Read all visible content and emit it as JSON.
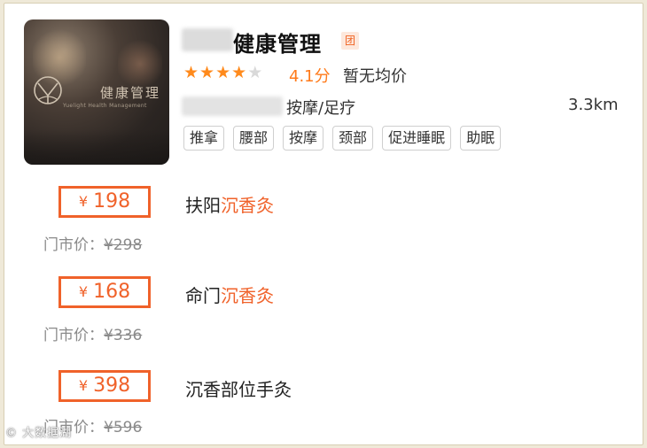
{
  "shop": {
    "name": "健康管理",
    "group_badge": "团",
    "rating": "4.1分",
    "avg_price": "暂无均价",
    "category": "按摩/足疗",
    "distance": "3.3km",
    "logo_text": "健康管理",
    "logo_subtext": "Yuelight Health Management",
    "star_count": 4,
    "star_max": 5,
    "tags": [
      "推拿",
      "腰部",
      "按摩",
      "颈部",
      "促进睡眠",
      "助眠"
    ]
  },
  "deals": [
    {
      "currency": "¥",
      "price": "198",
      "orig_label": "门市价：",
      "orig_price": "¥298",
      "title_prefix": "扶阳",
      "title_highlight": "沉香灸",
      "title_suffix": ""
    },
    {
      "currency": "¥",
      "price": "168",
      "orig_label": "门市价：",
      "orig_price": "¥336",
      "title_prefix": "命门",
      "title_highlight": "沉香灸",
      "title_suffix": ""
    },
    {
      "currency": "¥",
      "price": "398",
      "orig_label": "门市价：",
      "orig_price": "¥596",
      "title_prefix": "沉香部位手灸",
      "title_highlight": "",
      "title_suffix": ""
    }
  ],
  "watermark": "© 大数据湖",
  "colors": {
    "accent": "#f0622a",
    "star": "#ff8a1c",
    "star_off": "#d9d9d9",
    "text": "#222222",
    "muted": "#8a8a8a"
  }
}
